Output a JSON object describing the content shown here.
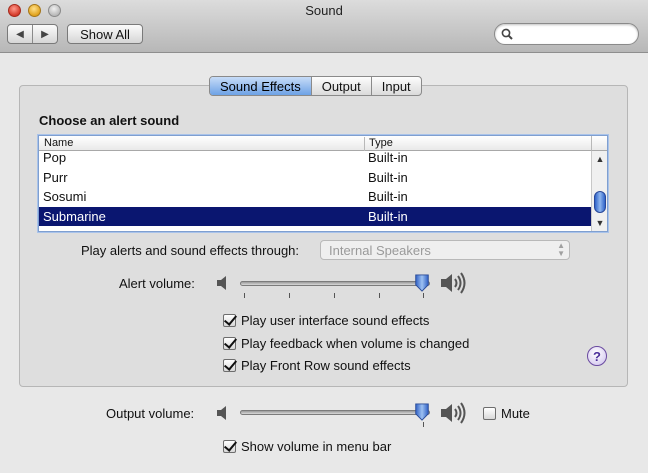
{
  "window": {
    "title": "Sound"
  },
  "toolbar": {
    "back_icon": "◀",
    "forward_icon": "▶",
    "show_all_label": "Show All",
    "search_placeholder": ""
  },
  "tabs": [
    {
      "label": "Sound Effects",
      "active": true
    },
    {
      "label": "Output",
      "active": false
    },
    {
      "label": "Input",
      "active": false
    }
  ],
  "alert_sounds": {
    "heading": "Choose an alert sound",
    "columns": {
      "name": "Name",
      "type": "Type"
    },
    "rows": [
      {
        "name": "Pop",
        "type": "Built-in"
      },
      {
        "name": "Purr",
        "type": "Built-in"
      },
      {
        "name": "Sosumi",
        "type": "Built-in"
      },
      {
        "name": "Submarine",
        "type": "Built-in",
        "selected": true
      }
    ],
    "selection_color": "#0a1670"
  },
  "play_through": {
    "label": "Play alerts and sound effects through:",
    "value": "Internal Speakers"
  },
  "alert_volume": {
    "label": "Alert volume:",
    "level": 1.0
  },
  "checkboxes": [
    {
      "label": "Play user interface sound effects",
      "checked": true
    },
    {
      "label": "Play feedback when volume is changed",
      "checked": true
    },
    {
      "label": "Play Front Row sound effects",
      "checked": true
    }
  ],
  "help_label": "?",
  "output_volume": {
    "label": "Output volume:",
    "level": 1.0,
    "mute_label": "Mute",
    "mute_checked": false
  },
  "menu_bar_checkbox": {
    "label": "Show volume in menu bar",
    "checked": true
  }
}
